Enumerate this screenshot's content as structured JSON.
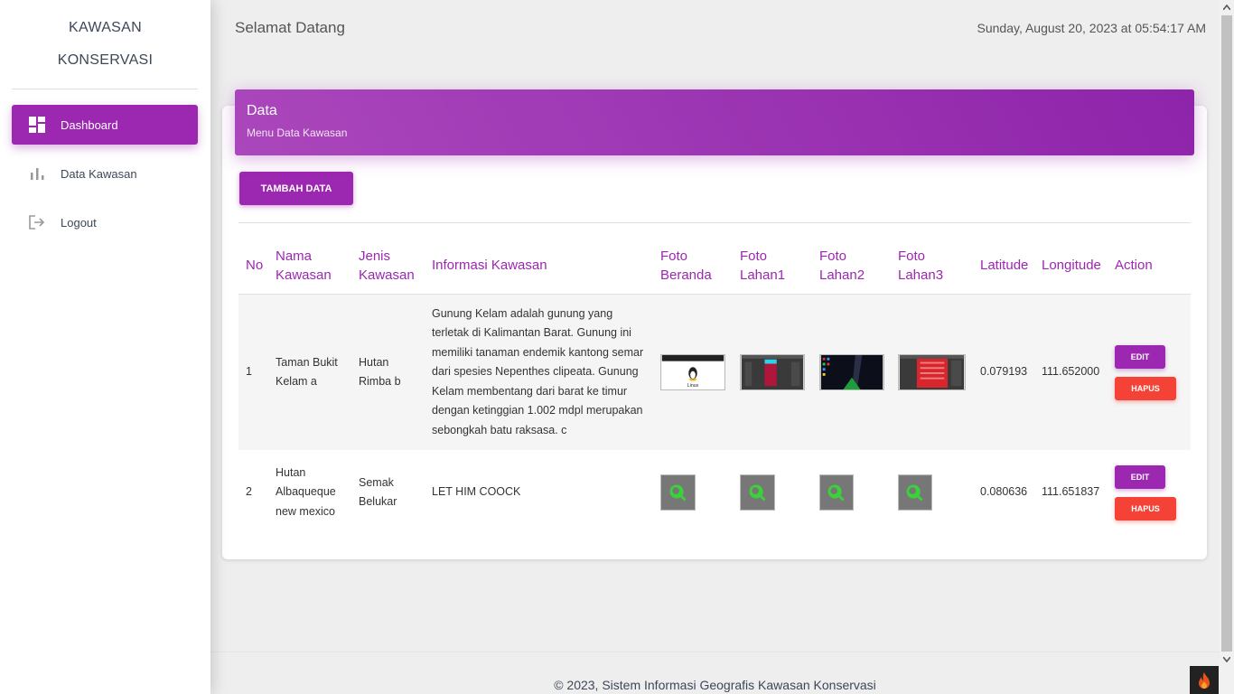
{
  "sidebar": {
    "brand_line1": "KAWASAN",
    "brand_line2": "KONSERVASI",
    "items": [
      {
        "label": "Dashboard",
        "icon": "dashboard-icon"
      },
      {
        "label": "Data Kawasan",
        "icon": "bar-chart-icon"
      },
      {
        "label": "Logout",
        "icon": "logout-icon"
      }
    ]
  },
  "header": {
    "title": "Selamat Datang",
    "datetime": "Sunday, August 20, 2023 at 05:54:17 AM"
  },
  "card": {
    "title": "Data",
    "subtitle": "Menu Data Kawasan",
    "add_button": "TAMBAH DATA"
  },
  "table": {
    "columns": [
      "No",
      "Nama Kawasan",
      "Jenis Kawasan",
      "Informasi Kawasan",
      "Foto Beranda",
      "Foto Lahan1",
      "Foto Lahan2",
      "Foto Lahan3",
      "Latitude",
      "Longitude",
      "Action"
    ],
    "rows": [
      {
        "no": "1",
        "nama": "Taman Bukit Kelam a",
        "jenis": "Hutan Rimba b",
        "informasi": "Gunung Kelam adalah gunung yang terletak di Kalimantan Barat. Gunung ini memiliki tanaman endemik kantong semar dari spesies Nepenthes clipeata. Gunung Kelam membentang dari barat ke timur dengan ketinggian 1.002 mdpl merupakan sebongkah batu raksasa. c",
        "latitude": "0.079193",
        "longitude": "111.652000",
        "photo_beranda_caption": "Linux",
        "edit_label": "EDIT",
        "delete_label": "HAPUS"
      },
      {
        "no": "2",
        "nama": "Hutan Albaqueque new mexico",
        "jenis": "Semak Belukar",
        "informasi": "LET HIM COOCK",
        "latitude": "0.080636",
        "longitude": "111.651837",
        "edit_label": "EDIT",
        "delete_label": "HAPUS"
      }
    ]
  },
  "footer": {
    "text": "© 2023, Sistem Informasi Geografis Kawasan Konservasi"
  },
  "colors": {
    "primary": "#9c27b0",
    "danger": "#f44336",
    "background": "#eeeeee"
  }
}
